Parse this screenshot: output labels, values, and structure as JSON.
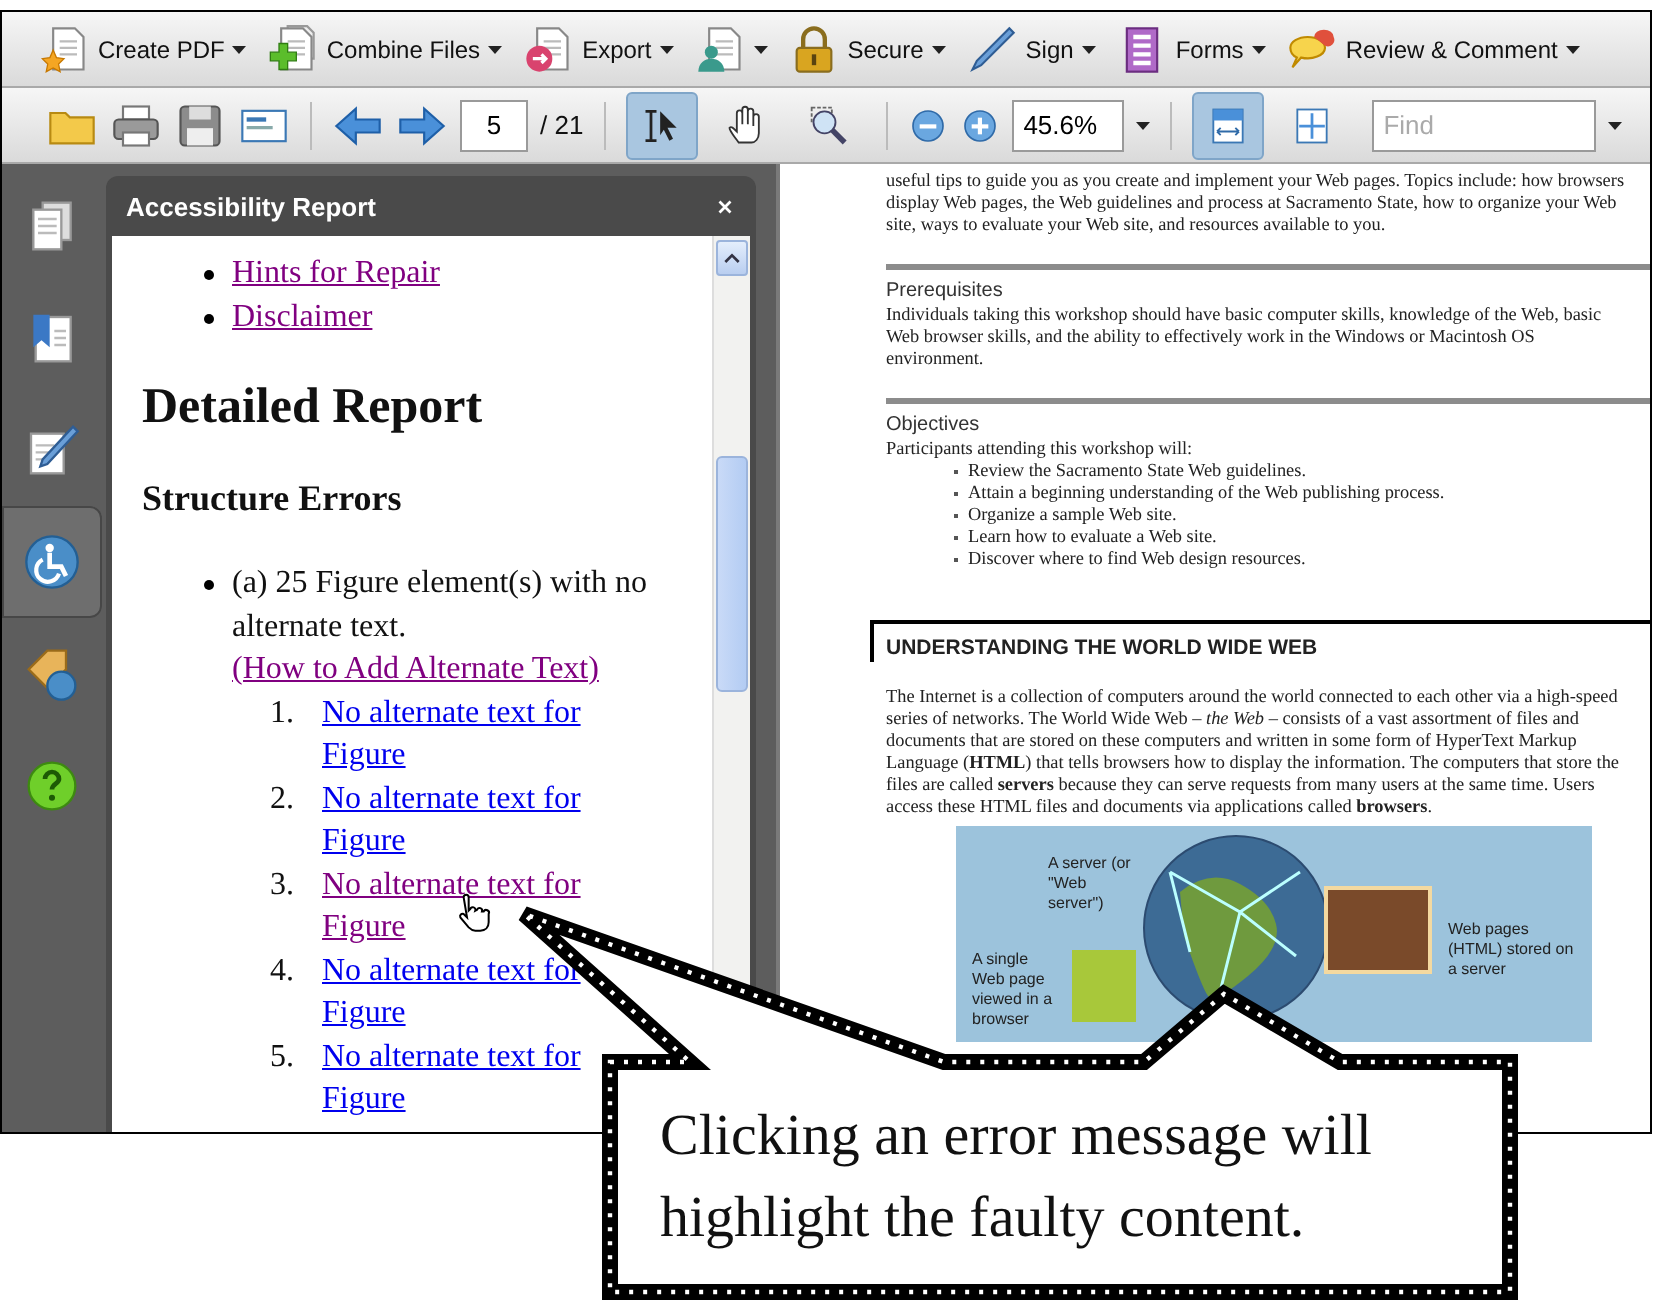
{
  "toolbar": [
    {
      "label": "Create PDF",
      "dropdown": true
    },
    {
      "label": "Combine Files",
      "dropdown": true
    },
    {
      "label": "Export",
      "dropdown": true
    },
    {
      "dropdown": true
    },
    {
      "label": "Secure",
      "dropdown": true
    },
    {
      "label": "Sign",
      "dropdown": true
    },
    {
      "label": "Forms",
      "dropdown": true
    },
    {
      "label": "Review & Comment",
      "dropdown": true
    }
  ],
  "nav_toolbar": {
    "page_field": {
      "value": "5"
    },
    "page_total": "/ 21",
    "tools": [
      {
        "selected": true
      },
      {
        "selected": false
      },
      {
        "selected": false
      }
    ],
    "zoom_field": {
      "value": "45.6%"
    },
    "view_modes": [
      {
        "selected": true
      },
      {
        "selected": false
      }
    ],
    "find_field": {
      "placeholder": "Find"
    }
  },
  "navigation_pane": [
    {
      "selected": false
    },
    {
      "selected": false
    },
    {
      "selected": false
    },
    {
      "selected": true
    },
    {
      "selected": false
    },
    {
      "selected": false
    }
  ],
  "accessibility_report": {
    "title": "Accessibility Report",
    "links": [
      {
        "text": "Hints for Repair",
        "visited": true
      },
      {
        "text": "Disclaimer",
        "visited": true
      }
    ],
    "heading": "Detailed Report",
    "subheading": "Structure Errors",
    "errors": [
      {
        "text": "(a) 25 Figure element(s) with no alternate text.",
        "help_link": {
          "text": "(How to Add Alternate Text)",
          "visited": true
        },
        "items": [
          {
            "number": "1.",
            "text": "No alternate text for Figure",
            "visited": false
          },
          {
            "number": "2.",
            "text": "No alternate text for Figure",
            "visited": false
          },
          {
            "number": "3.",
            "text": "No alternate text for Figure",
            "visited": true
          },
          {
            "number": "4.",
            "text": "No alternate text for Figure",
            "visited": false
          },
          {
            "number": "5.",
            "text": "No alternate text for Figure",
            "visited": false
          }
        ]
      }
    ]
  },
  "document": {
    "intro": "useful tips to guide you as you create and implement your Web pages. Topics include: how browsers display Web pages, the Web guidelines and process at Sacramento State, how to organize your Web site, ways to evaluate your Web site, and resources available to you.",
    "sections": [
      {
        "kind": "ruled",
        "heading": "Prerequisites",
        "paragraph": "Individuals taking this workshop should have basic computer skills, knowledge of the Web, basic Web browser skills, and the ability to effectively work in the Windows or Macintosh OS environment."
      },
      {
        "kind": "ruled",
        "heading": "Objectives",
        "paragraph": "Participants attending this workshop will:",
        "bullets": [
          "Review the Sacramento State Web guidelines.",
          "Attain a beginning understanding of the Web publishing process.",
          "Organize a sample Web site.",
          "Learn how to evaluate a Web site.",
          "Discover where to find Web design resources."
        ]
      },
      {
        "kind": "chapter",
        "heading": "UNDERSTANDING THE WORLD WIDE WEB",
        "paragraph": "The Internet is a collection of computers around the world connected to each other via a high-speed series of networks.  The World Wide Web – *the Web* – consists of a vast assortment of files and documents that are stored on these computers and written in some form of HyperText Markup Language (**HTML**) that tells browsers how to display the information.  The computers that store the files are called **servers** because they can serve requests from many users at the same time.  Users access these HTML files and documents via applications called **browsers**.",
        "figure": {
          "labels": [
            "A server (or \"Web server\")",
            "A single Web page viewed in a browser",
            "Web pages (HTML) stored on a server"
          ]
        }
      }
    ]
  },
  "callout": {
    "text": "Clicking an error message will highlight the faulty content."
  }
}
